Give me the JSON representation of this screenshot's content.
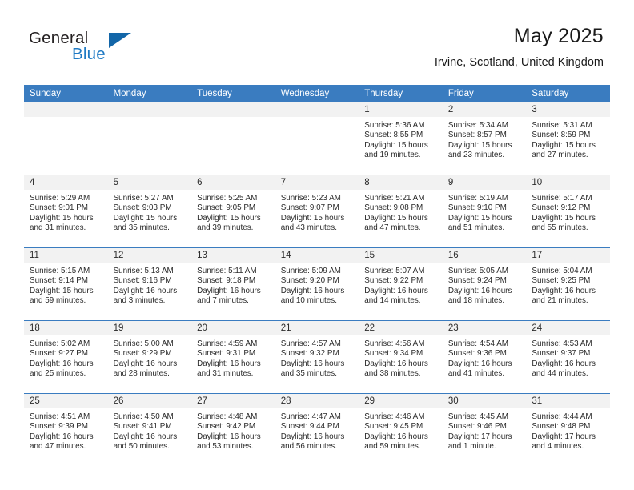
{
  "brand": {
    "name_part1": "General",
    "name_part2": "Blue",
    "flag_icon": "triangle-flag-icon"
  },
  "header": {
    "month_title": "May 2025",
    "location": "Irvine, Scotland, United Kingdom"
  },
  "colors": {
    "header_bar": "#3a7cc0",
    "daynum_band": "#f2f2f2",
    "brand_blue": "#1f7ac4",
    "flag_blue": "#1366a8",
    "text": "#2b2b2b"
  },
  "calendar": {
    "weekday_headers": [
      "Sunday",
      "Monday",
      "Tuesday",
      "Wednesday",
      "Thursday",
      "Friday",
      "Saturday"
    ],
    "weeks": [
      [
        {
          "day": "",
          "empty": true,
          "lines": [
            "",
            "",
            "",
            ""
          ]
        },
        {
          "day": "",
          "empty": true,
          "lines": [
            "",
            "",
            "",
            ""
          ]
        },
        {
          "day": "",
          "empty": true,
          "lines": [
            "",
            "",
            "",
            ""
          ]
        },
        {
          "day": "",
          "empty": true,
          "lines": [
            "",
            "",
            "",
            ""
          ]
        },
        {
          "day": "1",
          "empty": false,
          "lines": [
            "Sunrise: 5:36 AM",
            "Sunset: 8:55 PM",
            "Daylight: 15 hours",
            "and 19 minutes."
          ]
        },
        {
          "day": "2",
          "empty": false,
          "lines": [
            "Sunrise: 5:34 AM",
            "Sunset: 8:57 PM",
            "Daylight: 15 hours",
            "and 23 minutes."
          ]
        },
        {
          "day": "3",
          "empty": false,
          "lines": [
            "Sunrise: 5:31 AM",
            "Sunset: 8:59 PM",
            "Daylight: 15 hours",
            "and 27 minutes."
          ]
        }
      ],
      [
        {
          "day": "4",
          "empty": false,
          "lines": [
            "Sunrise: 5:29 AM",
            "Sunset: 9:01 PM",
            "Daylight: 15 hours",
            "and 31 minutes."
          ]
        },
        {
          "day": "5",
          "empty": false,
          "lines": [
            "Sunrise: 5:27 AM",
            "Sunset: 9:03 PM",
            "Daylight: 15 hours",
            "and 35 minutes."
          ]
        },
        {
          "day": "6",
          "empty": false,
          "lines": [
            "Sunrise: 5:25 AM",
            "Sunset: 9:05 PM",
            "Daylight: 15 hours",
            "and 39 minutes."
          ]
        },
        {
          "day": "7",
          "empty": false,
          "lines": [
            "Sunrise: 5:23 AM",
            "Sunset: 9:07 PM",
            "Daylight: 15 hours",
            "and 43 minutes."
          ]
        },
        {
          "day": "8",
          "empty": false,
          "lines": [
            "Sunrise: 5:21 AM",
            "Sunset: 9:08 PM",
            "Daylight: 15 hours",
            "and 47 minutes."
          ]
        },
        {
          "day": "9",
          "empty": false,
          "lines": [
            "Sunrise: 5:19 AM",
            "Sunset: 9:10 PM",
            "Daylight: 15 hours",
            "and 51 minutes."
          ]
        },
        {
          "day": "10",
          "empty": false,
          "lines": [
            "Sunrise: 5:17 AM",
            "Sunset: 9:12 PM",
            "Daylight: 15 hours",
            "and 55 minutes."
          ]
        }
      ],
      [
        {
          "day": "11",
          "empty": false,
          "lines": [
            "Sunrise: 5:15 AM",
            "Sunset: 9:14 PM",
            "Daylight: 15 hours",
            "and 59 minutes."
          ]
        },
        {
          "day": "12",
          "empty": false,
          "lines": [
            "Sunrise: 5:13 AM",
            "Sunset: 9:16 PM",
            "Daylight: 16 hours",
            "and 3 minutes."
          ]
        },
        {
          "day": "13",
          "empty": false,
          "lines": [
            "Sunrise: 5:11 AM",
            "Sunset: 9:18 PM",
            "Daylight: 16 hours",
            "and 7 minutes."
          ]
        },
        {
          "day": "14",
          "empty": false,
          "lines": [
            "Sunrise: 5:09 AM",
            "Sunset: 9:20 PM",
            "Daylight: 16 hours",
            "and 10 minutes."
          ]
        },
        {
          "day": "15",
          "empty": false,
          "lines": [
            "Sunrise: 5:07 AM",
            "Sunset: 9:22 PM",
            "Daylight: 16 hours",
            "and 14 minutes."
          ]
        },
        {
          "day": "16",
          "empty": false,
          "lines": [
            "Sunrise: 5:05 AM",
            "Sunset: 9:24 PM",
            "Daylight: 16 hours",
            "and 18 minutes."
          ]
        },
        {
          "day": "17",
          "empty": false,
          "lines": [
            "Sunrise: 5:04 AM",
            "Sunset: 9:25 PM",
            "Daylight: 16 hours",
            "and 21 minutes."
          ]
        }
      ],
      [
        {
          "day": "18",
          "empty": false,
          "lines": [
            "Sunrise: 5:02 AM",
            "Sunset: 9:27 PM",
            "Daylight: 16 hours",
            "and 25 minutes."
          ]
        },
        {
          "day": "19",
          "empty": false,
          "lines": [
            "Sunrise: 5:00 AM",
            "Sunset: 9:29 PM",
            "Daylight: 16 hours",
            "and 28 minutes."
          ]
        },
        {
          "day": "20",
          "empty": false,
          "lines": [
            "Sunrise: 4:59 AM",
            "Sunset: 9:31 PM",
            "Daylight: 16 hours",
            "and 31 minutes."
          ]
        },
        {
          "day": "21",
          "empty": false,
          "lines": [
            "Sunrise: 4:57 AM",
            "Sunset: 9:32 PM",
            "Daylight: 16 hours",
            "and 35 minutes."
          ]
        },
        {
          "day": "22",
          "empty": false,
          "lines": [
            "Sunrise: 4:56 AM",
            "Sunset: 9:34 PM",
            "Daylight: 16 hours",
            "and 38 minutes."
          ]
        },
        {
          "day": "23",
          "empty": false,
          "lines": [
            "Sunrise: 4:54 AM",
            "Sunset: 9:36 PM",
            "Daylight: 16 hours",
            "and 41 minutes."
          ]
        },
        {
          "day": "24",
          "empty": false,
          "lines": [
            "Sunrise: 4:53 AM",
            "Sunset: 9:37 PM",
            "Daylight: 16 hours",
            "and 44 minutes."
          ]
        }
      ],
      [
        {
          "day": "25",
          "empty": false,
          "lines": [
            "Sunrise: 4:51 AM",
            "Sunset: 9:39 PM",
            "Daylight: 16 hours",
            "and 47 minutes."
          ]
        },
        {
          "day": "26",
          "empty": false,
          "lines": [
            "Sunrise: 4:50 AM",
            "Sunset: 9:41 PM",
            "Daylight: 16 hours",
            "and 50 minutes."
          ]
        },
        {
          "day": "27",
          "empty": false,
          "lines": [
            "Sunrise: 4:48 AM",
            "Sunset: 9:42 PM",
            "Daylight: 16 hours",
            "and 53 minutes."
          ]
        },
        {
          "day": "28",
          "empty": false,
          "lines": [
            "Sunrise: 4:47 AM",
            "Sunset: 9:44 PM",
            "Daylight: 16 hours",
            "and 56 minutes."
          ]
        },
        {
          "day": "29",
          "empty": false,
          "lines": [
            "Sunrise: 4:46 AM",
            "Sunset: 9:45 PM",
            "Daylight: 16 hours",
            "and 59 minutes."
          ]
        },
        {
          "day": "30",
          "empty": false,
          "lines": [
            "Sunrise: 4:45 AM",
            "Sunset: 9:46 PM",
            "Daylight: 17 hours",
            "and 1 minute."
          ]
        },
        {
          "day": "31",
          "empty": false,
          "lines": [
            "Sunrise: 4:44 AM",
            "Sunset: 9:48 PM",
            "Daylight: 17 hours",
            "and 4 minutes."
          ]
        }
      ]
    ]
  }
}
